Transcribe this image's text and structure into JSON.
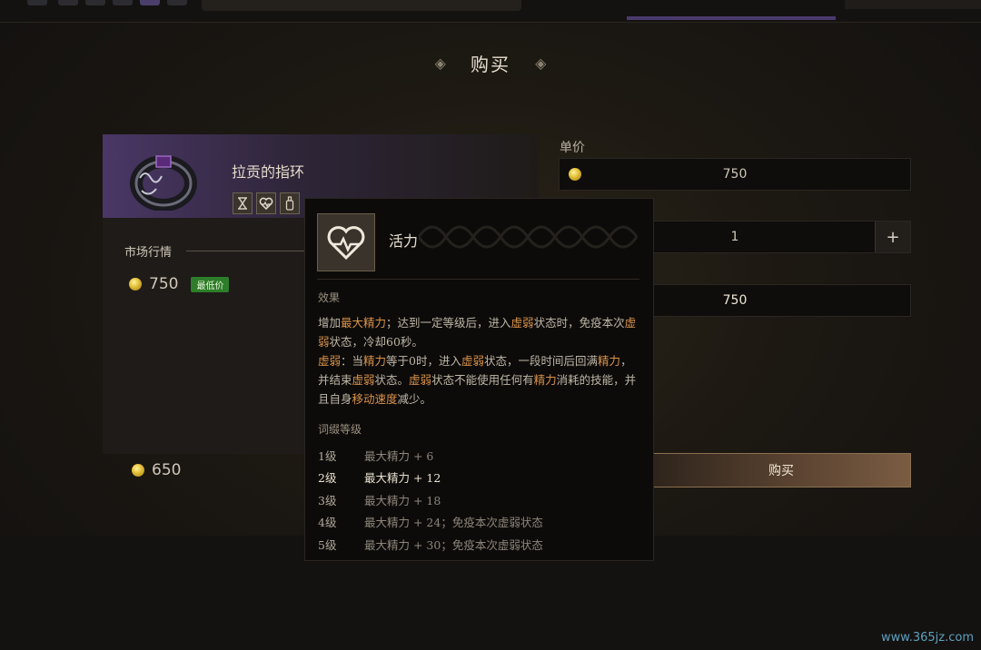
{
  "screen": {
    "title": "购买"
  },
  "item": {
    "name": "拉贡的指环",
    "tag_icons": [
      "hourglass-icon",
      "heart-pulse-icon",
      "bottle-icon"
    ]
  },
  "market": {
    "label": "市场行情",
    "lowest_price": "750",
    "lowest_badge": "最低价"
  },
  "wallet": {
    "balance": "650"
  },
  "purchase": {
    "unit_price_label": "单价",
    "unit_price": "750",
    "quantity": "1",
    "plus_label": "+",
    "total": "750",
    "buy_label": "购买"
  },
  "tooltip": {
    "title": "活力",
    "icon": "heart-pulse-icon",
    "effect_label": "效果",
    "effect_lines": [
      [
        {
          "t": "增加"
        },
        {
          "t": "最大精力",
          "h": true
        },
        {
          "t": "；达到一定等级后，进入"
        },
        {
          "t": "虚弱",
          "h": true
        },
        {
          "t": "状态时，免疫本次"
        },
        {
          "t": "虚弱",
          "h": true
        },
        {
          "t": "状态，冷却60秒。"
        }
      ],
      [
        {
          "t": "虚弱",
          "h": true
        },
        {
          "t": "：当"
        },
        {
          "t": "精力",
          "h": true
        },
        {
          "t": "等于0时，进入"
        },
        {
          "t": "虚弱",
          "h": true
        },
        {
          "t": "状态，一段时间后回满"
        },
        {
          "t": "精力",
          "h": true
        },
        {
          "t": "，并结束"
        },
        {
          "t": "虚弱",
          "h": true
        },
        {
          "t": "状态。"
        },
        {
          "t": "虚弱",
          "h": true
        },
        {
          "t": "状态不能使用任何有"
        },
        {
          "t": "精力",
          "h": true
        },
        {
          "t": "消耗的技能，并且自身"
        },
        {
          "t": "移动速度",
          "h": true
        },
        {
          "t": "减少。"
        }
      ]
    ],
    "levels_label": "词缀等级",
    "levels": [
      {
        "level": "1级",
        "desc": "最大精力 + 6",
        "active": false
      },
      {
        "level": "2级",
        "desc": "最大精力 + 12",
        "active": true
      },
      {
        "level": "3级",
        "desc": "最大精力 + 18",
        "active": false
      },
      {
        "level": "4级",
        "desc": "最大精力 + 24；免疫本次虚弱状态",
        "active": false
      },
      {
        "level": "5级",
        "desc": "最大精力 + 30；免疫本次虚弱状态",
        "active": false
      }
    ]
  },
  "watermark": "www.365jz.com",
  "colors": {
    "highlight": "#d9934a",
    "badge_green": "#2e7d2a",
    "rarity_purple": "#4a3766"
  }
}
